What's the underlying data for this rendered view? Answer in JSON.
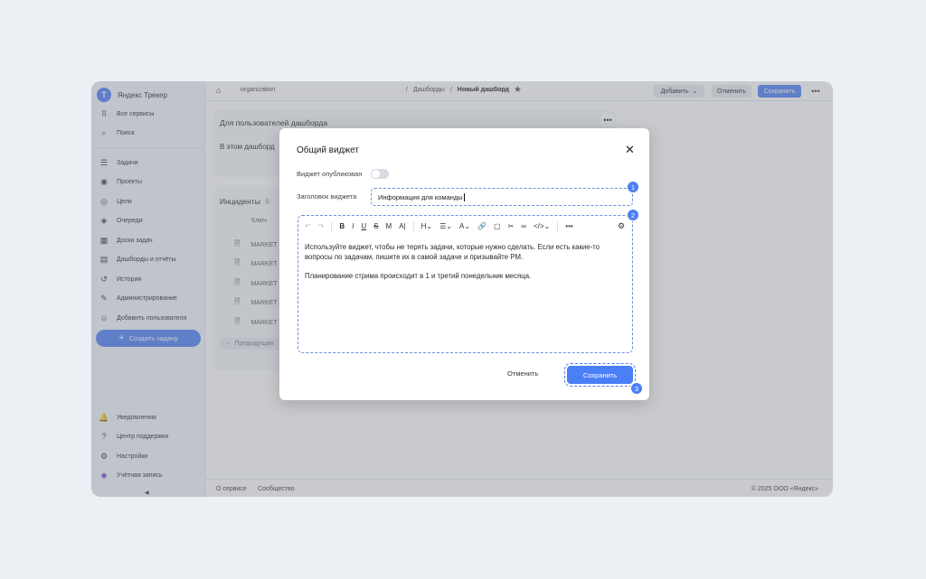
{
  "sidebar": {
    "logo_letter": "Т",
    "brand": "Яндекс Трекер",
    "top_items": [
      {
        "label": "Все сервисы",
        "icon": "⠿"
      },
      {
        "label": "Поиск",
        "icon": "⌕"
      }
    ],
    "items": [
      {
        "label": "Задачи",
        "icon": "☰"
      },
      {
        "label": "Проекты",
        "icon": "◉"
      },
      {
        "label": "Цели",
        "icon": "◎"
      },
      {
        "label": "Очереди",
        "icon": "◈"
      },
      {
        "label": "Доски задач",
        "icon": "▦"
      },
      {
        "label": "Дашборды и отчёты",
        "icon": "▤"
      },
      {
        "label": "История",
        "icon": "↺"
      },
      {
        "label": "Администрирование",
        "icon": "✎"
      },
      {
        "label": "Добавить пользователя",
        "icon": "☺"
      }
    ],
    "create_button": "Создать задачу",
    "bottom_items": [
      {
        "label": "Уведомления",
        "icon": "🔔"
      },
      {
        "label": "Центр поддержки",
        "icon": "?"
      },
      {
        "label": "Настройки",
        "icon": "⚙"
      },
      {
        "label": "Учётная запись",
        "icon": "◆"
      }
    ],
    "collapse": "◀"
  },
  "topbar": {
    "home_icon": "⌂",
    "organization": "organization",
    "breadcrumb_sep": "/",
    "breadcrumb_parent": "Дашборды",
    "breadcrumb_current": "Новый дашборд",
    "star": "★",
    "add_label": "Добавить",
    "cancel_label": "Отменить",
    "save_label": "Сохранить",
    "more": "•••"
  },
  "widgets": {
    "first_title": "Для пользователей дашборда",
    "first_text": "В этом дашборд",
    "second_title": "Инциденты",
    "second_count": "6",
    "column_key": "Ключ",
    "rows": [
      "MARKET",
      "MARKET",
      "MARKET",
      "MARKET",
      "MARKET"
    ],
    "prev_label": "Предыдущая"
  },
  "footer": {
    "about": "О сервисе",
    "community": "Сообщество",
    "copyright": "© 2025 ООО «Яндекс»"
  },
  "modal": {
    "title": "Общий виджет",
    "close": "✕",
    "published_label": "Виджет опубликован",
    "title_label": "Заголовок виджета",
    "title_value": "Информация для команды",
    "paragraph_1": "Используйте виджет, чтобы не терять задачи, которые нужно сделать. Если есть какие-то вопросы по задачам, пишите их в самой задаче и призывайте PM.",
    "paragraph_2": "Планирование стрима происходит в 1 и третий понедельник месяца.",
    "toolbar": {
      "undo": "↶",
      "redo": "↷",
      "bold": "B",
      "italic": "I",
      "underline": "U",
      "strike": "S",
      "mono": "M",
      "typo": "A|",
      "heading": "H⌄",
      "list": "☰⌄",
      "color": "A⌄",
      "link": "🔗",
      "note": "▢",
      "cut": "✂",
      "mention": "∞",
      "code": "</>⌄",
      "more": "•••",
      "settings": "⚙"
    },
    "cancel_label": "Отменить",
    "save_label": "Сохранить",
    "badges": [
      "1",
      "2",
      "3"
    ]
  },
  "colors": {
    "accent": "#4b7ff5",
    "overlay": "rgba(125,128,138,0.42)",
    "sidebar_bg": "#f2f4fb"
  }
}
